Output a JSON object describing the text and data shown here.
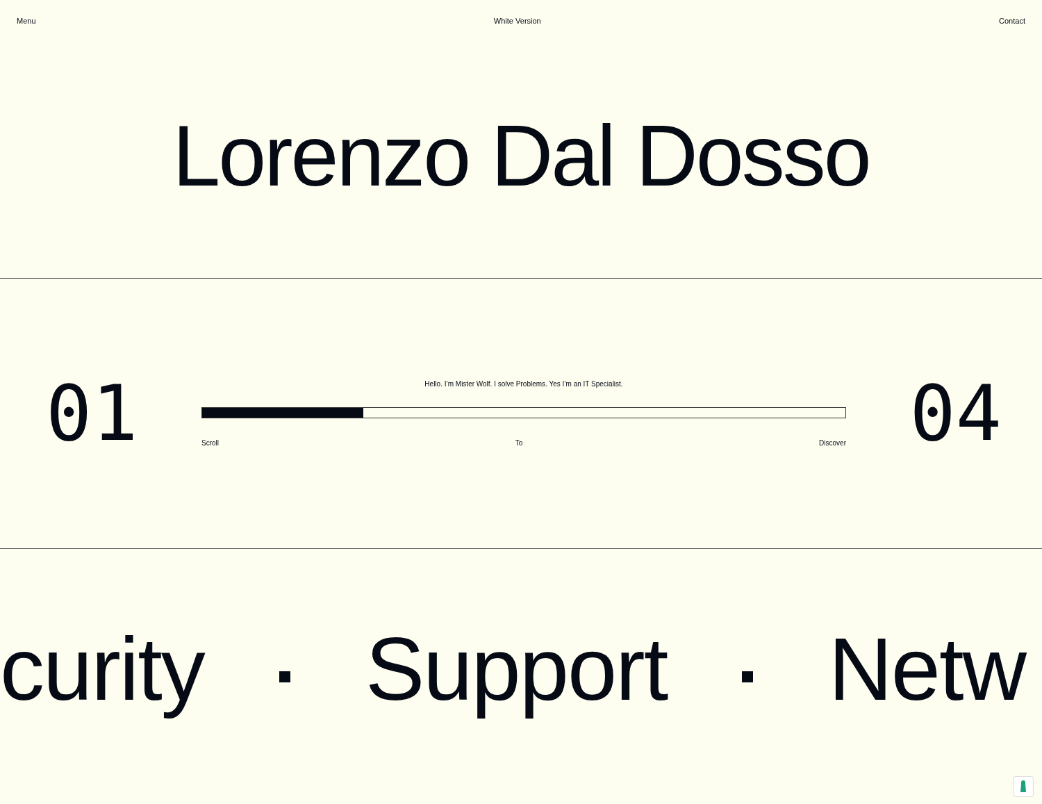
{
  "header": {
    "menu": "Menu",
    "version": "White Version",
    "contact": "Contact"
  },
  "hero": {
    "title": "Lorenzo Dal Dosso"
  },
  "progress": {
    "current": "01",
    "total": "04",
    "tagline": "Hello. I’m Mister Wolf. I solve Problems. Yes I’m an IT Specialist.",
    "level": 0.25,
    "labels": [
      "Scroll",
      "To",
      "Discover"
    ]
  },
  "marquee": {
    "items": [
      "curity",
      "Support",
      "Netw"
    ]
  }
}
